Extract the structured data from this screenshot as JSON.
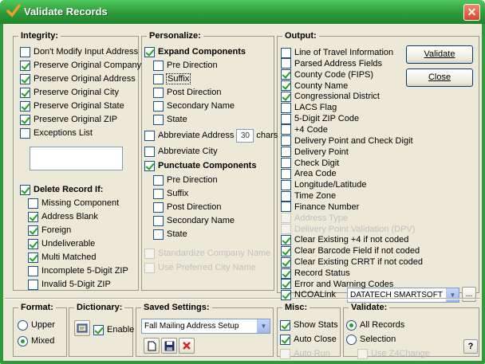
{
  "window": {
    "title": "Validate Records",
    "close_label": "✕"
  },
  "integrity": {
    "title": "Integrity:",
    "items": [
      {
        "label": "Don't Modify Input Address",
        "checked": false
      },
      {
        "label": "Preserve Original Company",
        "checked": true
      },
      {
        "label": "Preserve Original Address",
        "checked": true
      },
      {
        "label": "Preserve Original City",
        "checked": true
      },
      {
        "label": "Preserve Original State",
        "checked": true
      },
      {
        "label": "Preserve Original ZIP",
        "checked": true
      },
      {
        "label": "Exceptions List",
        "checked": false
      }
    ],
    "exceptions_text": ""
  },
  "delete_record": {
    "label": "Delete Record If:",
    "checked": true,
    "items": [
      {
        "label": "Missing Component",
        "checked": false
      },
      {
        "label": "Address Blank",
        "checked": true
      },
      {
        "label": "Foreign",
        "checked": true
      },
      {
        "label": "Undeliverable",
        "checked": true
      },
      {
        "label": "Multi Matched",
        "checked": true
      },
      {
        "label": "Incomplete 5-Digit ZIP",
        "checked": false
      },
      {
        "label": "Invalid 5-Digit ZIP",
        "checked": false
      }
    ]
  },
  "personalize": {
    "title": "Personalize:",
    "expand": {
      "label": "Expand Components",
      "checked": true
    },
    "expand_items": [
      {
        "label": "Pre Direction",
        "checked": false
      },
      {
        "label": "Suffix",
        "checked": false
      },
      {
        "label": "Post Direction",
        "checked": false
      },
      {
        "label": "Secondary Name",
        "checked": false
      },
      {
        "label": "State",
        "checked": false
      }
    ],
    "abbrev_address": {
      "label": "Abbreviate Address",
      "value": "30",
      "suffix": "chars",
      "checked": false
    },
    "abbrev_city": {
      "label": "Abbreviate City",
      "checked": false
    },
    "punctuate": {
      "label": "Punctuate Components",
      "checked": true
    },
    "punctuate_items": [
      {
        "label": "Pre Direction",
        "checked": false
      },
      {
        "label": "Suffix",
        "checked": false
      },
      {
        "label": "Post Direction",
        "checked": false
      },
      {
        "label": "Secondary Name",
        "checked": false
      },
      {
        "label": "State",
        "checked": false
      }
    ],
    "standardize_company": "Standardize Company Name",
    "preferred_city": "Use Preferred City Name"
  },
  "output": {
    "title": "Output:",
    "items": [
      {
        "label": "Line of Travel Information",
        "checked": false,
        "disabled": false
      },
      {
        "label": "Parsed Address Fields",
        "checked": false,
        "disabled": false
      },
      {
        "label": "County Code (FIPS)",
        "checked": true,
        "disabled": false
      },
      {
        "label": "County Name",
        "checked": true,
        "disabled": false
      },
      {
        "label": "Congressional District",
        "checked": true,
        "disabled": false
      },
      {
        "label": "LACS Flag",
        "checked": false,
        "disabled": false
      },
      {
        "label": "5-Digit ZIP Code",
        "checked": false,
        "disabled": false
      },
      {
        "label": "+4 Code",
        "checked": false,
        "disabled": false
      },
      {
        "label": "Delivery Point and Check Digit",
        "checked": false,
        "disabled": false
      },
      {
        "label": "Delivery Point",
        "checked": false,
        "disabled": false
      },
      {
        "label": "Check Digit",
        "checked": false,
        "disabled": false
      },
      {
        "label": "Area Code",
        "checked": false,
        "disabled": false
      },
      {
        "label": "Longitude/Latitude",
        "checked": false,
        "disabled": false
      },
      {
        "label": "Time Zone",
        "checked": false,
        "disabled": false
      },
      {
        "label": "Finance Number",
        "checked": false,
        "disabled": false
      },
      {
        "label": "Address Type",
        "checked": false,
        "disabled": true
      },
      {
        "label": "Delivery Point Validation (DPV)",
        "checked": false,
        "disabled": true
      },
      {
        "label": "Clear Existing +4 if not coded",
        "checked": true,
        "disabled": false
      },
      {
        "label": "Clear Barcode Field if not coded",
        "checked": true,
        "disabled": false
      },
      {
        "label": "Clear Existing CRRT if not coded",
        "checked": true,
        "disabled": false
      },
      {
        "label": "Record Status",
        "checked": true,
        "disabled": false
      },
      {
        "label": "Error and Warning Codes",
        "checked": true,
        "disabled": false
      }
    ],
    "ncoalink": {
      "label": "NCOALink",
      "checked": true
    },
    "ncoalink_provider": "DATATECH SMARTSOFT",
    "ellipsis": "..."
  },
  "buttons": {
    "validate": "Validate",
    "close": "Close",
    "help": "?"
  },
  "format": {
    "title": "Format:",
    "options": [
      {
        "label": "Upper",
        "checked": false
      },
      {
        "label": "Mixed",
        "checked": true
      }
    ]
  },
  "dictionary": {
    "title": "Dictionary:",
    "enable": {
      "label": "Enable",
      "checked": true
    }
  },
  "saved_settings": {
    "title": "Saved Settings:",
    "selected": "Fall Mailing Address Setup"
  },
  "misc": {
    "title": "Misc:",
    "items": [
      {
        "label": "Show Stats",
        "checked": true,
        "disabled": false
      },
      {
        "label": "Auto Close",
        "checked": true,
        "disabled": false
      },
      {
        "label": "Auto Run",
        "checked": false,
        "disabled": true
      }
    ]
  },
  "validate": {
    "title": "Validate:",
    "options": [
      {
        "label": "All Records",
        "checked": true
      },
      {
        "label": "Selection",
        "checked": false
      }
    ],
    "use_z4change": {
      "label": "Use Z4Change",
      "checked": false
    }
  },
  "colors": {
    "titlebar": "#2f9a3c",
    "check": "#21a121",
    "dialog_bg": "#ece9d8",
    "close": "#d8452b"
  }
}
